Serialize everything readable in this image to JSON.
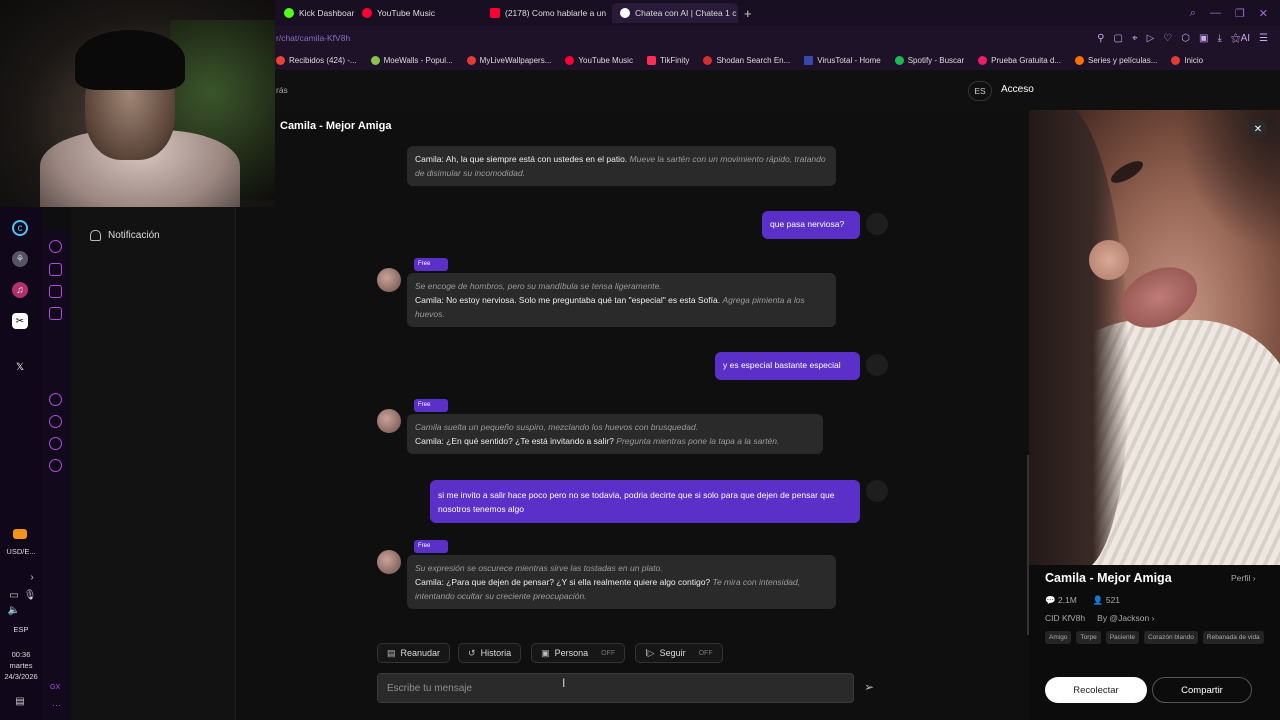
{
  "browser": {
    "tabs": [
      {
        "label": "Kick Dashboard",
        "color": "#53fc18",
        "active": false
      },
      {
        "label": "YouTube Music",
        "color": "#ff0033",
        "active": false
      },
      {
        "label": "(2178) Como hablarle a un",
        "color": "#ff0033",
        "active": false
      },
      {
        "label": "Chatea con AI | Chatea 1 c",
        "color": "#ffffff",
        "active": true
      }
    ],
    "new_tab": "+",
    "url": "r/chat/camila-KfV8h",
    "bookmarks": [
      {
        "label": "Recibidos (424) -...",
        "color": "#ea4335"
      },
      {
        "label": "MoeWalls - Popul...",
        "color": "#8bc34a"
      },
      {
        "label": "MyLiveWallpapers...",
        "color": "#e53935"
      },
      {
        "label": "YouTube Music",
        "color": "#ff0033"
      },
      {
        "label": "TikFinity",
        "color": "#ff2d55"
      },
      {
        "label": "Shodan Search En...",
        "color": "#d32f2f"
      },
      {
        "label": "VirusTotal - Home",
        "color": "#3949ab"
      },
      {
        "label": "Spotify - Buscar",
        "color": "#1db954"
      },
      {
        "label": "Prueba Gratuita d...",
        "color": "#e91e63"
      },
      {
        "label": "Series y películas...",
        "color": "#ff6f00"
      },
      {
        "label": "Inicio",
        "color": "#e53935"
      }
    ]
  },
  "system": {
    "currency": "USD/E...",
    "lang": "ESP",
    "time": "00:36",
    "day": "martes",
    "date": "24/3/2026",
    "gx": "GX"
  },
  "site": {
    "back_fragment": "rás",
    "notification_label": "Notificación",
    "lang_button": "ES",
    "login": "Acceso",
    "chat_title": "Camila - Mejor Amiga"
  },
  "messages": {
    "m1_speech": "Camila: Ah, la que siempre está con ustedes en el patio.",
    "m1_action": "Mueve la sartén con un movimiento rápido, tratando de disimular su incomodidad.",
    "m2": "que pasa nerviosa?",
    "m3_action1": "Se encoge de hombros, pero su mandíbula se tensa ligeramente.",
    "m3_speech": "Camila: No estoy nerviosa. Solo me preguntaba qué tan \"especial\" es esta Sofía.",
    "m3_action2": "Agrega pimienta a los huevos.",
    "m4": "y es especial bastante especial",
    "m5_action1": "Camila suelta un pequeño suspiro, mezclando los huevos con brusquedad.",
    "m5_speech": "Camila: ¿En qué sentido? ¿Te está invitando a salir?",
    "m5_action2": "Pregunta mientras pone la tapa a la sartén.",
    "m6": "si me invito a salir hace poco pero no se todavia, podria decirte que si solo para que dejen de pensar que nosotros tenemos algo",
    "m7_action1": "Su expresión se oscurece mientras sirve las tostadas en un plato.",
    "m7_speech": "Camila: ¿Para que dejen de pensar? ¿Y si ella realmente quiere algo contigo?",
    "m7_action2": "Te mira con intensidad, intentando ocultar su creciente preocupación.",
    "free_badge": "Free"
  },
  "controls": {
    "reanudar": "Reanudar",
    "historia": "Historia",
    "persona": "Persona",
    "persona_state": "OFF",
    "seguir": "Seguir",
    "seguir_state": "OFF"
  },
  "input": {
    "placeholder": "Escribe tu mensaje"
  },
  "profile": {
    "name": "Camila - Mejor Amiga",
    "perfil_link": "Perfil",
    "chats": "2.1M",
    "followers": "521",
    "cid": "CID KfV8h",
    "author": "By @Jackson",
    "tags": [
      "Amigo",
      "Torpe",
      "Paciente",
      "Corazón blando",
      "Rebanada de vida"
    ],
    "recollect": "Recolectar",
    "share": "Compartir"
  }
}
